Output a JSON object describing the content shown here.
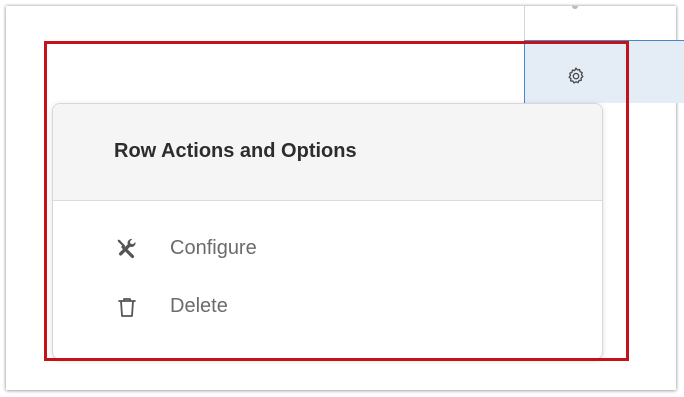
{
  "popover": {
    "title": "Row Actions and Options",
    "items": [
      {
        "label": "Configure",
        "icon": "tools-icon"
      },
      {
        "label": "Delete",
        "icon": "trash-icon"
      }
    ]
  },
  "row": {
    "settings_icon": "gear-icon"
  },
  "colors": {
    "highlight": "#c4121a",
    "selected_cell_bg": "#e4ecf5",
    "selected_cell_border": "#4b87c8",
    "header_bg": "#f5f5f5",
    "title_text": "#2d2d2d",
    "item_text": "#6b6b6b"
  }
}
